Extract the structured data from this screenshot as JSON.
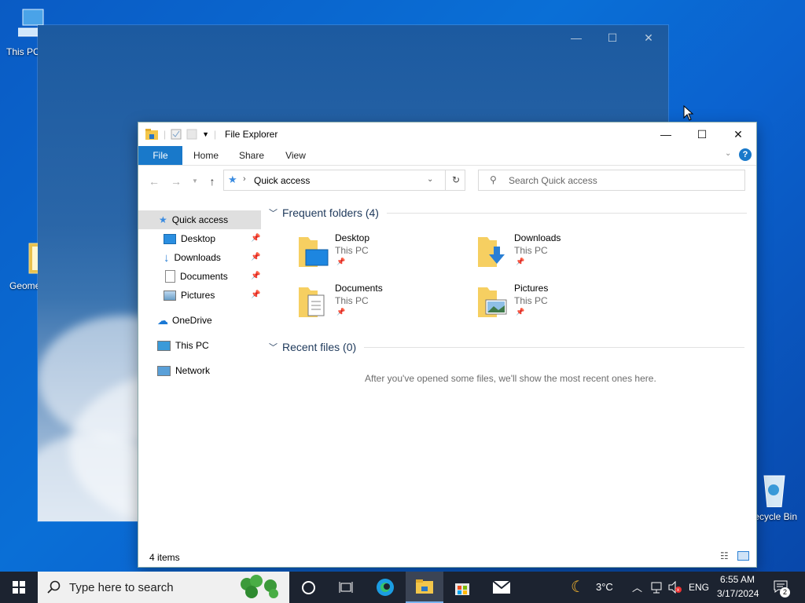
{
  "desktop": {
    "icons": [
      {
        "label": "This PC"
      },
      {
        "label": "Geometry Dash"
      },
      {
        "label": "Recycle Bin"
      }
    ]
  },
  "explorer": {
    "title": "File Explorer",
    "tabs": {
      "file": "File",
      "home": "Home",
      "share": "Share",
      "view": "View"
    },
    "address": "Quick access",
    "search_placeholder": "Search Quick access",
    "sidebar": {
      "quick_access": "Quick access",
      "desktop": "Desktop",
      "downloads": "Downloads",
      "documents": "Documents",
      "pictures": "Pictures",
      "onedrive": "OneDrive",
      "this_pc": "This PC",
      "network": "Network"
    },
    "frequent_header": "Frequent folders (4)",
    "folders": [
      {
        "name": "Desktop",
        "location": "This PC"
      },
      {
        "name": "Downloads",
        "location": "This PC"
      },
      {
        "name": "Documents",
        "location": "This PC"
      },
      {
        "name": "Pictures",
        "location": "This PC"
      }
    ],
    "recent_header": "Recent files (0)",
    "empty_message": "After you've opened some files, we'll show the most recent ones here.",
    "status": "4 items"
  },
  "taskbar": {
    "search_placeholder": "Type here to search",
    "weather": "3°C",
    "language": "ENG",
    "time": "6:55 AM",
    "date": "3/17/2024",
    "notification_count": "2"
  }
}
